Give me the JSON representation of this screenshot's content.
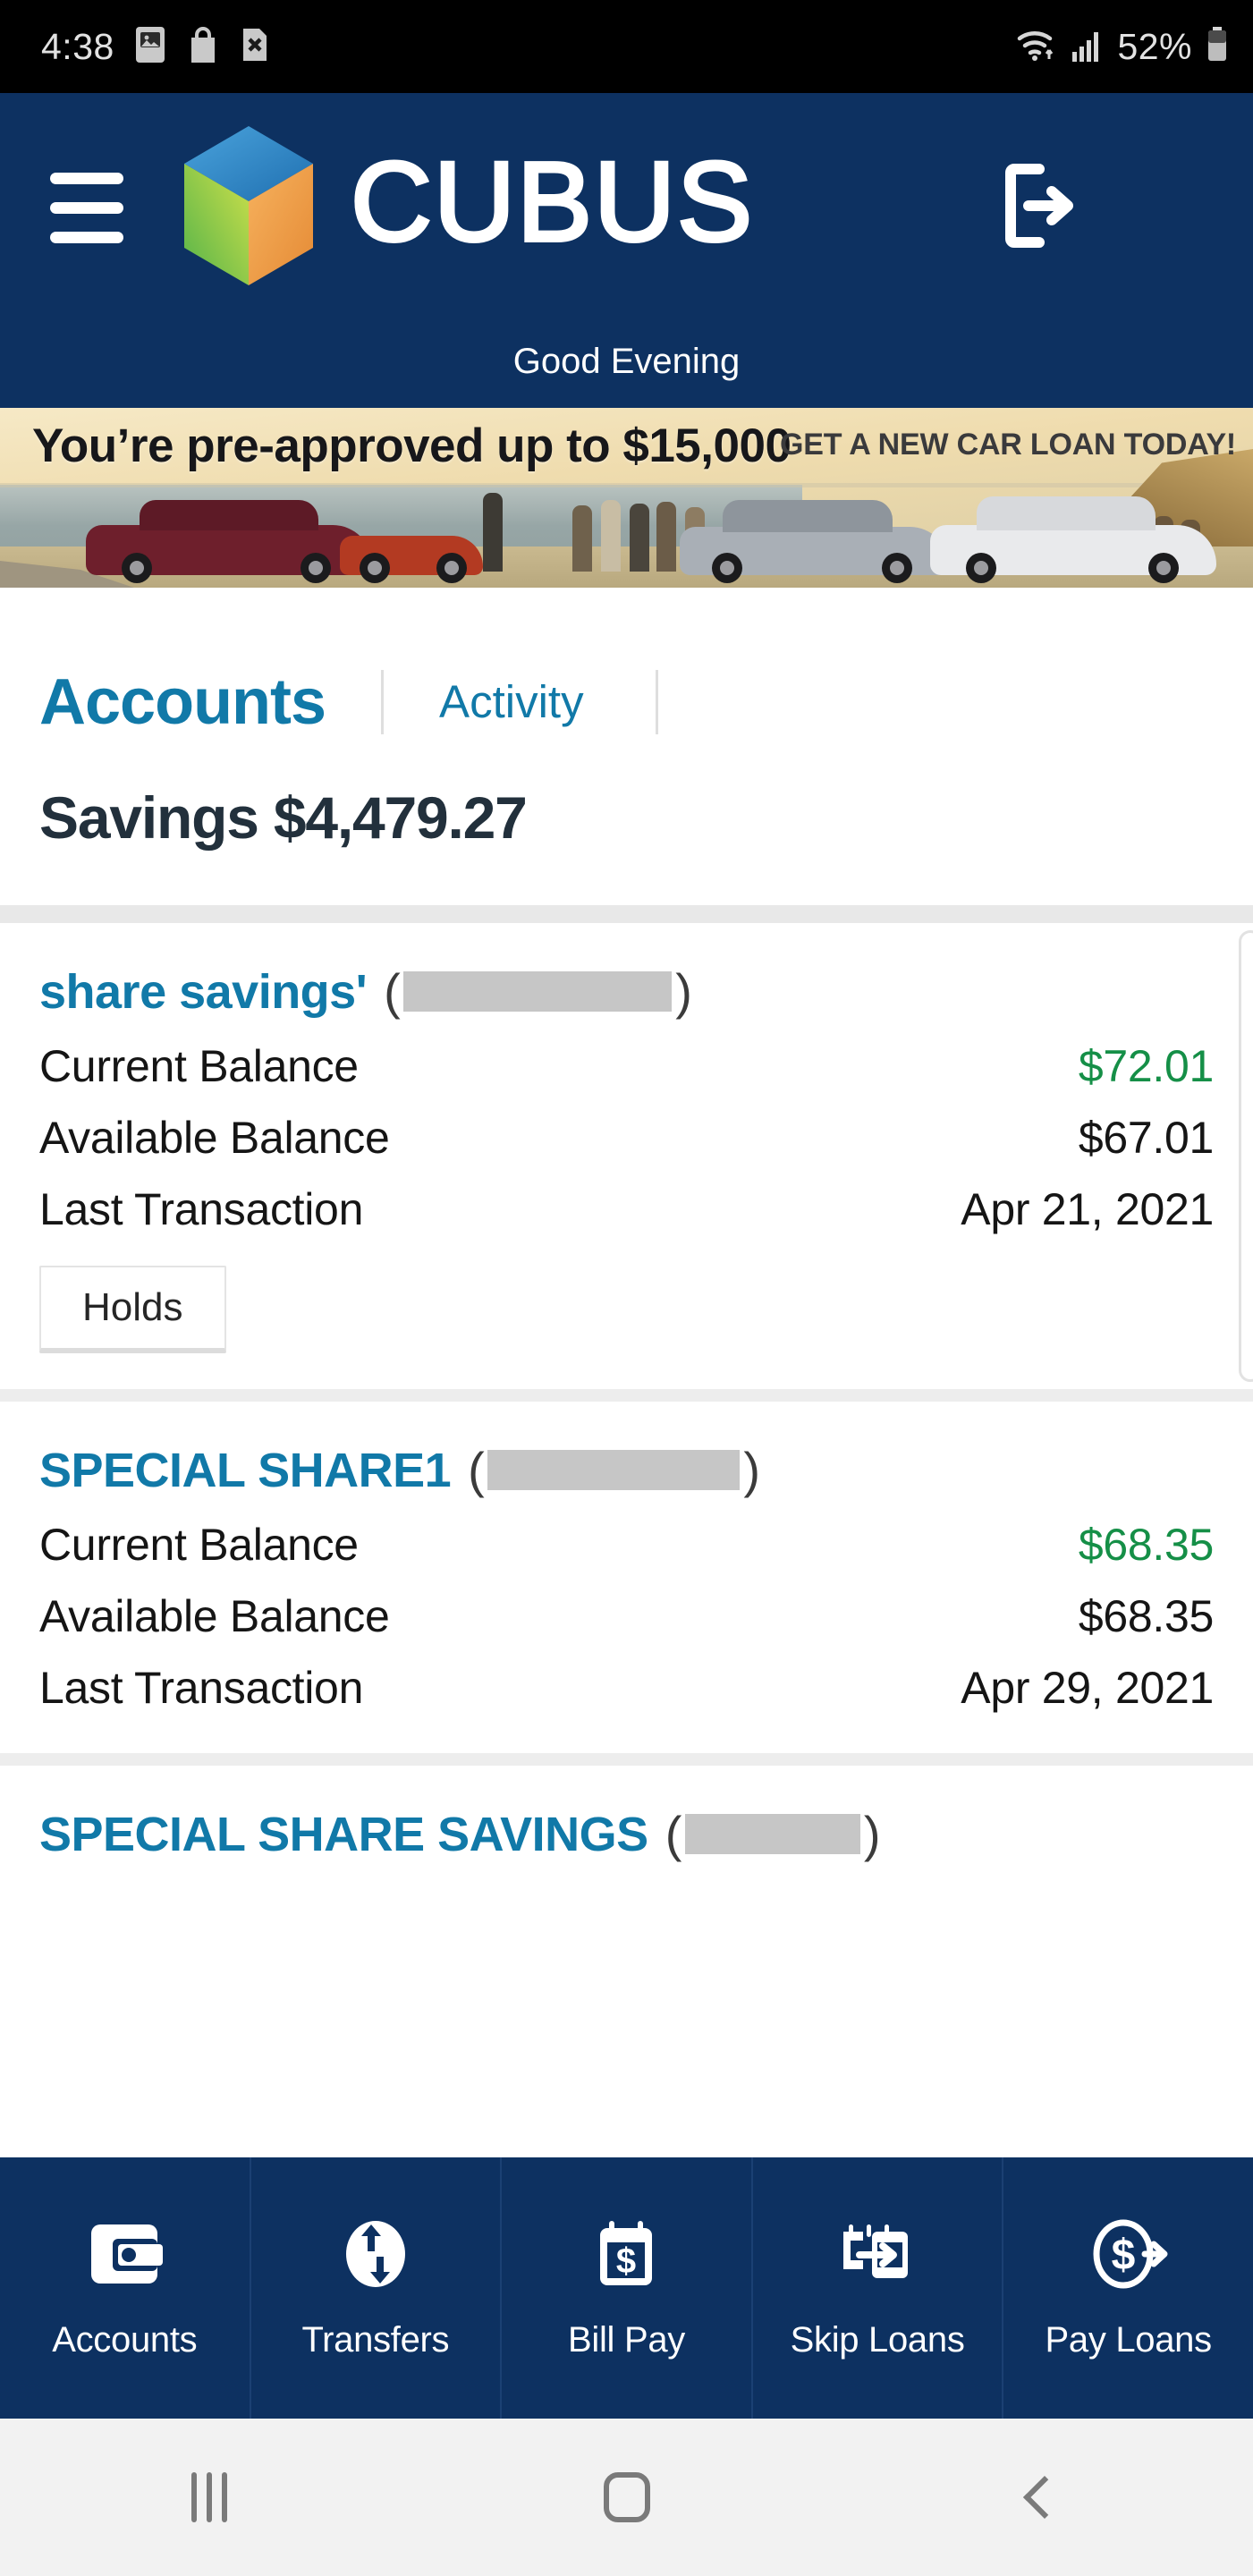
{
  "status_bar": {
    "clock": "4:38",
    "battery_percent": "52%",
    "left_icons": [
      "image-icon",
      "shopping-bag-icon",
      "sim-x-icon"
    ],
    "right_icons": [
      "wifi-icon",
      "cellular-signal-icon",
      "battery-icon"
    ]
  },
  "header": {
    "menu_icon": "hamburger-menu-icon",
    "logo_icon": "cubus-cube-logo",
    "brand": "CUBUS",
    "logout_icon": "logout-icon",
    "greeting": "Good Evening",
    "background_color": "#0d3161"
  },
  "ad_banner": {
    "headline": "You’re pre-approved up to $15,000",
    "subhead": "GET A NEW CAR LOAN TODAY!"
  },
  "tabs": [
    {
      "label": "Accounts",
      "active": true
    },
    {
      "label": "Activity",
      "active": false
    }
  ],
  "section": {
    "title": "Savings $4,479.27"
  },
  "labels": {
    "current_balance": "Current Balance",
    "available_balance": "Available Balance",
    "last_transaction": "Last Transaction",
    "holds_button": "Holds"
  },
  "accounts": [
    {
      "name": "share savings'",
      "masked_number": "",
      "current_balance": "$72.01",
      "available_balance": "$67.01",
      "last_transaction": "Apr 21, 2021",
      "has_holds": true
    },
    {
      "name": "SPECIAL SHARE1",
      "masked_number": "",
      "current_balance": "$68.35",
      "available_balance": "$68.35",
      "last_transaction": "Apr 29, 2021",
      "has_holds": false
    },
    {
      "name": "SPECIAL SHARE SAVINGS",
      "masked_number": "",
      "current_balance": "",
      "available_balance": "",
      "last_transaction": "",
      "has_holds": false
    }
  ],
  "bottom_nav": [
    {
      "label": "Accounts",
      "icon": "wallet-icon"
    },
    {
      "label": "Transfers",
      "icon": "transfer-arrows-icon"
    },
    {
      "label": "Bill Pay",
      "icon": "calendar-dollar-icon"
    },
    {
      "label": "Skip Loans",
      "icon": "calendar-arrow-icon"
    },
    {
      "label": "Pay Loans",
      "icon": "dollar-circle-arrow-icon"
    }
  ],
  "android_nav": [
    {
      "name": "recents-button"
    },
    {
      "name": "home-button"
    },
    {
      "name": "back-button"
    }
  ],
  "colors": {
    "brand_navy": "#0d3161",
    "accent_teal": "#1179a8",
    "positive_green": "#158f47",
    "text_dark": "#22303c"
  }
}
